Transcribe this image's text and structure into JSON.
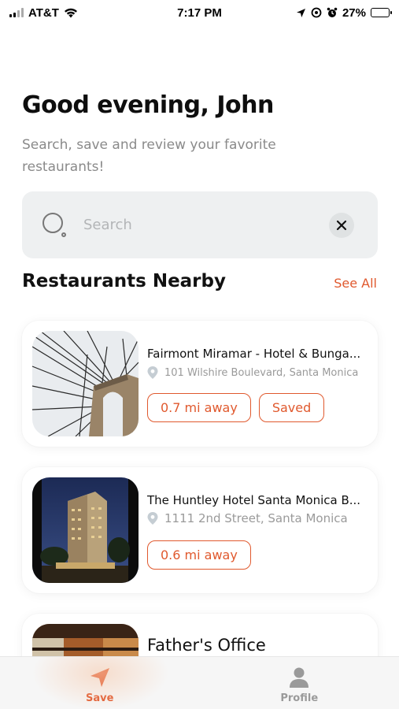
{
  "status_bar": {
    "carrier": "AT&T",
    "time": "7:17 PM",
    "battery": "27%"
  },
  "header": {
    "greeting": "Good evening, John",
    "subtitle": "Search, save and review your favorite restaurants!"
  },
  "search": {
    "placeholder": "Search",
    "value": ""
  },
  "section": {
    "title": "Restaurants Nearby",
    "see_all_label": "See All"
  },
  "restaurants": [
    {
      "name": "Fairmont Miramar - Hotel & Bunga...",
      "address": "101 Wilshire Boulevard, Santa Monica",
      "distance": "0.7 mi away",
      "saved_label": "Saved"
    },
    {
      "name": "The Huntley Hotel Santa Monica B...",
      "address": "1111 2nd Street, Santa Monica",
      "distance": "0.6 mi away"
    },
    {
      "name": "Father's Office"
    }
  ],
  "tab_bar": {
    "save_label": "Save",
    "profile_label": "Profile"
  },
  "colors": {
    "accent": "#e0592e",
    "search_bg": "#eef0f1",
    "muted_text": "#8a8a8a"
  },
  "icons": {
    "search": "search-icon",
    "clear": "close-icon",
    "pin": "location-pin-icon",
    "save_tab": "navigation-arrow-icon",
    "profile_tab": "person-icon"
  }
}
